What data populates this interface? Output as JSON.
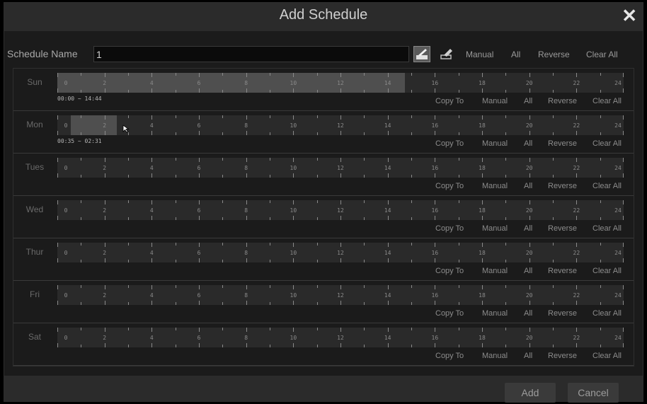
{
  "dialog": {
    "title": "Add Schedule",
    "close_icon": "close-icon"
  },
  "name_row": {
    "label": "Schedule Name",
    "value": "1",
    "tools": [
      "draw-tool-icon",
      "erase-tool-icon"
    ],
    "actions": [
      "Manual",
      "All",
      "Reverse",
      "Clear All"
    ]
  },
  "hour_labels": [
    "0",
    "2",
    "4",
    "6",
    "8",
    "10",
    "12",
    "14",
    "16",
    "18",
    "20",
    "22",
    "24"
  ],
  "days": [
    {
      "name": "Sun",
      "range_text": "00:00 ~ 14:44",
      "selection": {
        "start_hour": 0.0,
        "end_hour": 14.733
      }
    },
    {
      "name": "Mon",
      "range_text": "00:35 ~ 02:31",
      "selection": {
        "start_hour": 0.583,
        "end_hour": 2.517
      }
    },
    {
      "name": "Tues",
      "range_text": "",
      "selection": null
    },
    {
      "name": "Wed",
      "range_text": "",
      "selection": null
    },
    {
      "name": "Thur",
      "range_text": "",
      "selection": null
    },
    {
      "name": "Fri",
      "range_text": "",
      "selection": null
    },
    {
      "name": "Sat",
      "range_text": "",
      "selection": null
    }
  ],
  "row_actions": [
    "Copy To",
    "Manual",
    "All",
    "Reverse",
    "Clear All"
  ],
  "footer": {
    "add_label": "Add",
    "cancel_label": "Cancel"
  },
  "colors": {
    "background": "#1b1b1b",
    "track": "#2a2a2a",
    "selection": "#4f4f4f",
    "titlebar": "#2b2b2b"
  }
}
